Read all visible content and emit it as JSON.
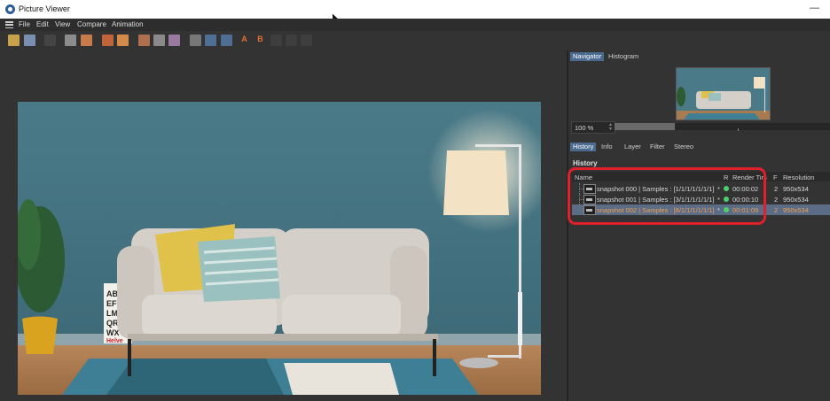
{
  "window": {
    "title": "Picture Viewer",
    "minimize_glyph": "—"
  },
  "menu": {
    "items": [
      "File",
      "Edit",
      "View",
      "Compare",
      "Animation"
    ]
  },
  "toolbar": {
    "compare_a_label": "A",
    "compare_b_label": "B"
  },
  "navigator": {
    "tabs": [
      "Navigator",
      "Histogram"
    ],
    "zoom_value": "100 %",
    "zoom_fraction": 0.28
  },
  "history": {
    "tabs": [
      "History",
      "Info",
      "Layer",
      "Filter",
      "Stereo"
    ],
    "title": "History",
    "columns": {
      "name": "Name",
      "r": "R",
      "render_time": "Render Tim",
      "f": "F",
      "resolution": "Resolution"
    },
    "rows": [
      {
        "name": "snapshot 000  |   Samples : [1/1/1/1/1/1/1]",
        "mark": "*",
        "time": "00:00:02",
        "f": "2",
        "resolution": "950x534",
        "selected": false
      },
      {
        "name": "snapshot 001  |   Samples : [3/1/1/1/1/1/1]",
        "mark": "*",
        "time": "00:00:10",
        "f": "2",
        "resolution": "950x534",
        "selected": false
      },
      {
        "name": "snapshot 002  |   Samples : [8/1/1/1/1/1/1]",
        "mark": "*",
        "time": "00:01:09",
        "f": "2",
        "resolution": "950x534",
        "selected": true
      }
    ]
  },
  "poster": {
    "lines": [
      "ABC",
      "EFG",
      "LMO",
      "QRS",
      "WXY"
    ],
    "brand": "Helve",
    "sub": "LBET"
  },
  "colors": {
    "accent_tab": "#4a6a8f",
    "selected_row": "#5b6c86",
    "status_green": "#4cd06a",
    "highlight_red": "#e0202a"
  }
}
